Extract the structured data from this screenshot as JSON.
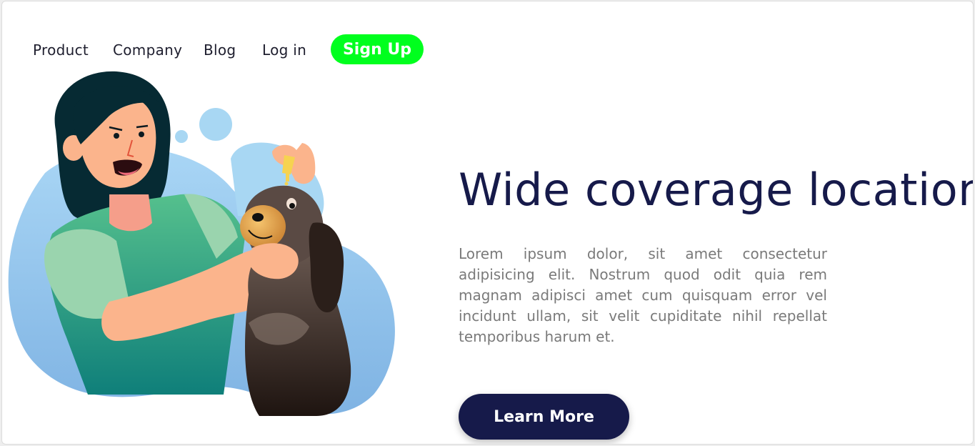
{
  "nav": {
    "links": [
      "Product",
      "Company",
      "Blog",
      "Log in"
    ],
    "signup_label": "Sign Up"
  },
  "hero": {
    "title": "Wide coverage location",
    "body": "Lorem ipsum dolor, sit amet consectetur adipisicing elit. Nostrum quod odit quia rem magnam adipisci amet cum quisquam error vel incidunt ullam, sit velit cupiditate nihil repellat temporibus harum et.",
    "cta_label": "Learn More"
  },
  "colors": {
    "accent_green": "#00ff1e",
    "navy": "#161a4a",
    "blob_blue": "#8fc3ea"
  },
  "illustration": {
    "subject": "woman-giving-eye-drops-to-dog",
    "icons": [
      "dropper-icon"
    ]
  }
}
